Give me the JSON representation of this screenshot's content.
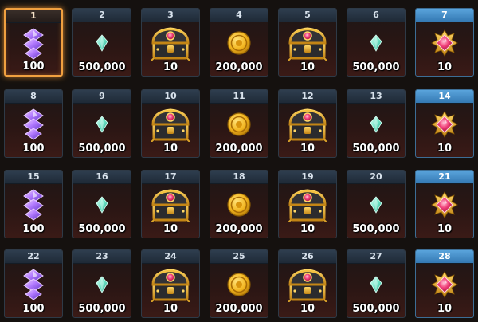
{
  "rewards": [
    {
      "day": "1",
      "amount": "100",
      "icon": "crystal-shard-icon",
      "state": "current"
    },
    {
      "day": "2",
      "amount": "500,000",
      "icon": "gem-icon"
    },
    {
      "day": "3",
      "amount": "10",
      "icon": "treasure-chest-icon"
    },
    {
      "day": "4",
      "amount": "200,000",
      "icon": "gold-coin-icon"
    },
    {
      "day": "5",
      "amount": "10",
      "icon": "treasure-chest-icon"
    },
    {
      "day": "6",
      "amount": "500,000",
      "icon": "gem-icon"
    },
    {
      "day": "7",
      "amount": "10",
      "icon": "ruby-star-icon",
      "state": "special"
    },
    {
      "day": "8",
      "amount": "100",
      "icon": "crystal-shard-icon"
    },
    {
      "day": "9",
      "amount": "500,000",
      "icon": "gem-icon"
    },
    {
      "day": "10",
      "amount": "10",
      "icon": "treasure-chest-icon"
    },
    {
      "day": "11",
      "amount": "200,000",
      "icon": "gold-coin-icon"
    },
    {
      "day": "12",
      "amount": "10",
      "icon": "treasure-chest-icon"
    },
    {
      "day": "13",
      "amount": "500,000",
      "icon": "gem-icon"
    },
    {
      "day": "14",
      "amount": "10",
      "icon": "ruby-star-icon",
      "state": "special"
    },
    {
      "day": "15",
      "amount": "100",
      "icon": "crystal-shard-icon"
    },
    {
      "day": "16",
      "amount": "500,000",
      "icon": "gem-icon"
    },
    {
      "day": "17",
      "amount": "10",
      "icon": "treasure-chest-icon"
    },
    {
      "day": "18",
      "amount": "200,000",
      "icon": "gold-coin-icon"
    },
    {
      "day": "19",
      "amount": "10",
      "icon": "treasure-chest-icon"
    },
    {
      "day": "20",
      "amount": "500,000",
      "icon": "gem-icon"
    },
    {
      "day": "21",
      "amount": "10",
      "icon": "ruby-star-icon",
      "state": "special"
    },
    {
      "day": "22",
      "amount": "100",
      "icon": "crystal-shard-icon"
    },
    {
      "day": "23",
      "amount": "500,000",
      "icon": "gem-icon"
    },
    {
      "day": "24",
      "amount": "10",
      "icon": "treasure-chest-icon"
    },
    {
      "day": "25",
      "amount": "200,000",
      "icon": "gold-coin-icon"
    },
    {
      "day": "26",
      "amount": "10",
      "icon": "treasure-chest-icon"
    },
    {
      "day": "27",
      "amount": "500,000",
      "icon": "gem-icon"
    },
    {
      "day": "28",
      "amount": "10",
      "icon": "ruby-star-icon",
      "state": "special"
    }
  ],
  "colors": {
    "current_border": "#f0a040",
    "special_header": "#4a90c8",
    "normal_header": "#2a3644"
  }
}
